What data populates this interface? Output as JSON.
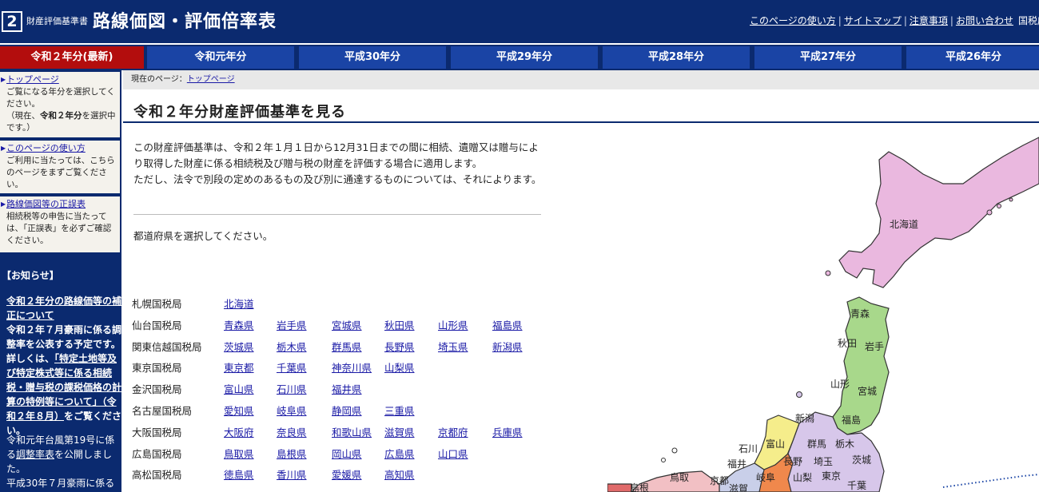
{
  "header": {
    "logo_number": "2",
    "subtitle": "財産評価基準書",
    "title": "路線価図・評価倍率表",
    "links": [
      "このページの使い方",
      "サイトマップ",
      "注意事項",
      "お問い合わせ"
    ],
    "agency": "国税庁"
  },
  "tabs": [
    "令和２年分(最新)",
    "令和元年分",
    "平成30年分",
    "平成29年分",
    "平成28年分",
    "平成27年分",
    "平成26年分"
  ],
  "colors": {
    "header_bg": "#0b2a6f",
    "tab_bg": "#1a44a5",
    "active_tab": "#b30d0d"
  },
  "sidebar": {
    "top_link": "トップページ",
    "top_text_1": "ご覧になる年分を選択してください。",
    "top_text_2a": "（現在、",
    "top_text_2b": "令和２年分",
    "top_text_2c": "を選択中です。）",
    "howto_link": "このページの使い方",
    "howto_text": "ご利用に当たっては、こちらのページをまずご覧ください。",
    "errata_link": "路線価図等の正誤表",
    "errata_text": "相続税等の申告に当たっては、「正誤表」を必ずご確認ください。",
    "news_heading": "【お知らせ】",
    "news_1": "令和２年分の路線価等の補正について",
    "news_2": "令和２年７月豪雨に係る調整率を公表する予定です。詳しくは、",
    "news_2_link": "「特定土地等及び特定株式等に係る相続税・贈与税の課税価格の計算の特例等について」（令和２年８月）",
    "news_2_tail": "をご覧ください。",
    "news_3": "令和元年台風第19号に係る",
    "news_3_link": "調整率表",
    "news_3_tail": "を公開しました。",
    "news_4": "平成30年７月豪雨に係る"
  },
  "breadcrumb": {
    "prefix": "現在のページ：",
    "link": "トップページ"
  },
  "main": {
    "title": "令和２年分財産評価基準を見る",
    "intro_1": "この財産評価基準は、令和２年１月１日から12月31日までの間に相続、遺贈又は贈与により取得した財産に係る相続税及び贈与税の財産を評価する場合に適用します。",
    "intro_2": "ただし、法令で別段の定めのあるもの及び別に通達するものについては、それによります。",
    "select_prompt": "都道府県を選択してください。"
  },
  "bureaus": [
    {
      "name": "札幌国税局",
      "prefs": [
        "北海道"
      ]
    },
    {
      "name": "仙台国税局",
      "prefs": [
        "青森県",
        "岩手県",
        "宮城県",
        "秋田県",
        "山形県",
        "福島県"
      ]
    },
    {
      "name": "関東信越国税局",
      "prefs": [
        "茨城県",
        "栃木県",
        "群馬県",
        "長野県",
        "埼玉県",
        "新潟県"
      ]
    },
    {
      "name": "東京国税局",
      "prefs": [
        "東京都",
        "千葉県",
        "神奈川県",
        "山梨県"
      ]
    },
    {
      "name": "金沢国税局",
      "prefs": [
        "富山県",
        "石川県",
        "福井県"
      ]
    },
    {
      "name": "名古屋国税局",
      "prefs": [
        "愛知県",
        "岐阜県",
        "静岡県",
        "三重県"
      ]
    },
    {
      "name": "大阪国税局",
      "prefs": [
        "大阪府",
        "奈良県",
        "和歌山県",
        "滋賀県",
        "京都府",
        "兵庫県"
      ]
    },
    {
      "name": "広島国税局",
      "prefs": [
        "鳥取県",
        "島根県",
        "岡山県",
        "広島県",
        "山口県"
      ]
    },
    {
      "name": "高松国税局",
      "prefs": [
        "徳島県",
        "香川県",
        "愛媛県",
        "高知県"
      ]
    }
  ],
  "map": {
    "labels": {
      "hokkaido": "北海道",
      "aomori": "青森",
      "akita": "秋田",
      "iwate": "岩手",
      "yamagata": "山形",
      "miyagi": "宮城",
      "niigata": "新潟",
      "fukushima": "福島",
      "ishikawa": "石川",
      "toyama": "富山",
      "gunma": "群馬",
      "tochigi": "栃木",
      "fukui": "福井",
      "nagano": "長野",
      "saitama": "埼玉",
      "ibaraki": "茨城",
      "gifu": "岐阜",
      "yamanashi": "山梨",
      "tokyo": "東京",
      "chiba": "千葉",
      "kyoto": "京都",
      "tottori": "鳥取",
      "shimane": "島根",
      "shiga": "滋賀"
    }
  }
}
